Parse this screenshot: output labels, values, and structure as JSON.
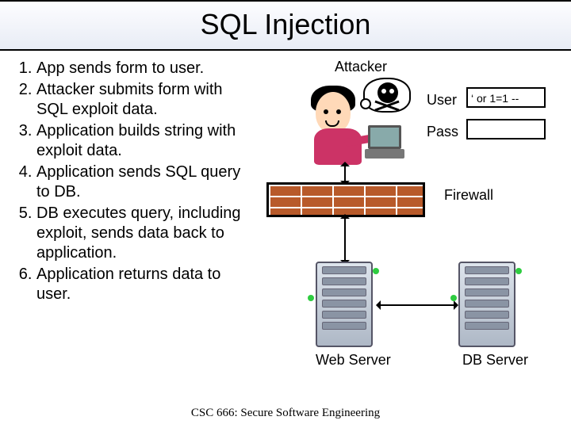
{
  "title": "SQL Injection",
  "steps": [
    "App sends form to user.",
    "Attacker submits form with SQL exploit data.",
    "Application builds string with exploit data.",
    "Application sends SQL query to DB.",
    "DB executes query, including exploit, sends data back to application.",
    "Application returns data to user."
  ],
  "diagram": {
    "attacker_label": "Attacker",
    "firewall_label": "Firewall",
    "web_server_label": "Web Server",
    "db_server_label": "DB Server",
    "form": {
      "user_label": "User",
      "user_value": "‘ or 1=1 --",
      "pass_label": "Pass",
      "pass_value": ""
    }
  },
  "footer": "CSC 666: Secure Software Engineering"
}
